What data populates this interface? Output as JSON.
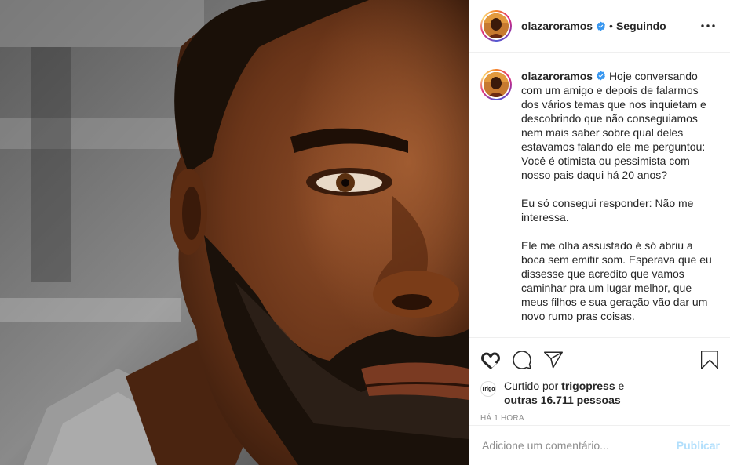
{
  "post": {
    "photo_icon": "portrait-photo",
    "header": {
      "username": "olazaroramos",
      "separator": "•",
      "follow_label": "Seguindo",
      "more_icon": "more-horizontal-icon",
      "verified_icon": "verified-badge-icon"
    },
    "caption": {
      "username": "olazaroramos",
      "paragraphs": [
        "Hoje conversando com um amigo e depois de falarmos dos vários temas que nos inquietam e descobrindo que não conseguiamos nem mais saber sobre qual deles estavamos falando ele me perguntou: Você é otimista ou pessimista com nosso pais daqui há 20 anos?",
        "Eu só consegui responder: Não me interessa.",
        "Ele me olha assustado é só abriu a boca sem emitir som. Esperava que eu dissesse que acredito que vamos caminhar pra um lugar melhor, que meus filhos e sua geração vão dar um novo rumo pras coisas."
      ]
    },
    "actions": {
      "like_icon": "heart-icon",
      "comment_icon": "comment-icon",
      "share_icon": "paper-plane-icon",
      "save_icon": "bookmark-icon"
    },
    "likes": {
      "liker_avatar_text": "Trigo",
      "prefix": "Curtido por ",
      "liker": "trigopress",
      "conjunction": " e",
      "others": "outras 16.711 pessoas"
    },
    "time_ago": "HÁ 1 HORA",
    "comment": {
      "placeholder": "Adicione um comentário...",
      "publish_label": "Publicar"
    },
    "colors": {
      "verified": "#3897f0",
      "publish_disabled": "#b2dffc",
      "muted": "#8e8e8e"
    }
  }
}
